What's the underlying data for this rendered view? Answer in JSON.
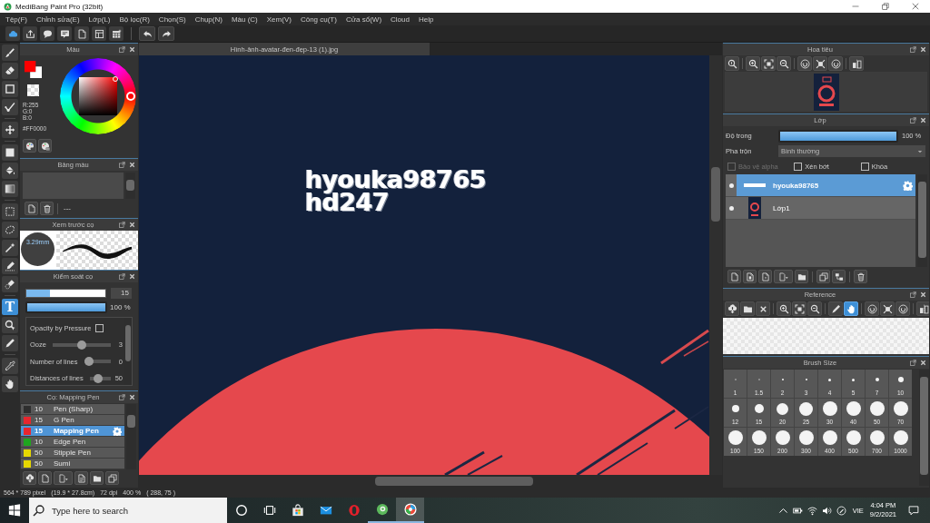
{
  "window": {
    "title": "MediBang Paint Pro (32bit)"
  },
  "menu": [
    "Tệp(F)",
    "Chỉnh sửa(E)",
    "Lớp(L)",
    "Bộ lọc(R)",
    "Chọn(S)",
    "Chụp(N)",
    "Màu (C)",
    "Xem(V)",
    "Công cụ(T)",
    "Cửa sổ(W)",
    "Cloud",
    "Help"
  ],
  "tools": [
    {
      "selected": false
    },
    {
      "selected": false
    },
    {
      "selected": false
    },
    {
      "selected": false
    },
    {
      "selected": false
    },
    {
      "selected": false
    },
    {
      "selected": false
    },
    {
      "selected": false
    },
    {
      "selected": false
    },
    {
      "selected": false
    },
    {
      "selected": false
    },
    {
      "selected": false
    },
    {
      "selected": false
    },
    {
      "label": "T",
      "selected": true
    },
    {
      "selected": false
    },
    {
      "selected": false
    },
    {
      "selected": false
    },
    {
      "selected": false
    }
  ],
  "color_panel": {
    "title": "Màu",
    "swatches": [
      {
        "color": "#ff0000"
      },
      {
        "color": "#ffffff"
      }
    ],
    "channels": [
      "R:255",
      "G:0",
      "B:0"
    ],
    "hex": "#FF0000"
  },
  "palette_panel": {
    "title": "Bảng màu",
    "palette_name": "---"
  },
  "brush_preview": {
    "title": "Xem trước cọ",
    "size": "3.29mm"
  },
  "brush_control": {
    "title": "Kiểm soát cọ",
    "size": {
      "level": 0.3,
      "value": "15"
    },
    "opacity": {
      "level": 1,
      "value": "100 %"
    },
    "options": [
      {
        "kind": "checkbox",
        "label": "Opacity by Pressure",
        "checked": false
      },
      {
        "kind": "slider",
        "label": "Ooze",
        "level": 0.5,
        "value": "3"
      },
      {
        "kind": "slider",
        "label": "Number of lines",
        "level": 0,
        "value": "0"
      },
      {
        "kind": "slider",
        "label": "Distances of lines",
        "level": 0.3,
        "value": "50"
      }
    ]
  },
  "brush_list": {
    "title": "Cọ: Mapping Pen",
    "items": [
      {
        "size": "10",
        "name": "Pen (Sharp)",
        "color": "#2e2e2e",
        "selected": false
      },
      {
        "size": "15",
        "name": "G Pen",
        "color": "#e8262e",
        "selected": false
      },
      {
        "size": "15",
        "name": "Mapping Pen",
        "color": "#e8262e",
        "selected": true
      },
      {
        "size": "10",
        "name": "Edge Pen",
        "color": "#1fa61f",
        "selected": false
      },
      {
        "size": "50",
        "name": "Stipple Pen",
        "color": "#e6d800",
        "selected": false
      },
      {
        "size": "50",
        "name": "Sumi",
        "color": "#e6d800",
        "selected": false
      }
    ]
  },
  "document": {
    "tab": "Hình-ảnh-avatar-đen-đẹp-13 (1).jpg",
    "text_lines": [
      "hyouka98765",
      "hd247"
    ]
  },
  "navigator": {
    "title": "Hoa tiêu"
  },
  "layers": {
    "title": "Lớp",
    "opacity": {
      "label": "Độ trong",
      "level": 1,
      "value": "100 %"
    },
    "blend": {
      "label": "Pha trộn",
      "value": "Bình thường"
    },
    "options": [
      {
        "label": "Bảo vệ alpha",
        "checked": false,
        "disabled": true
      },
      {
        "label": "Xén bớt",
        "checked": false,
        "disabled": false
      },
      {
        "label": "Khóa",
        "checked": false,
        "disabled": false
      }
    ],
    "items": [
      {
        "kind": "text",
        "name": "hyouka98765",
        "selected": true,
        "visible": true
      },
      {
        "kind": "image",
        "name": "Lớp1",
        "selected": false,
        "visible": true
      }
    ]
  },
  "reference": {
    "title": "Reference",
    "tools": [
      {
        "selected": false
      },
      {
        "selected": false
      },
      {
        "selected": false
      },
      {
        "selected": false
      },
      {
        "selected": false
      },
      {
        "selected": false
      },
      {
        "selected": false
      },
      {
        "selected": true
      },
      {
        "selected": false
      },
      {
        "selected": false
      },
      {
        "selected": false
      },
      {
        "selected": false
      }
    ]
  },
  "brush_size": {
    "title": "Brush Size",
    "sizes": [
      "1",
      "1.5",
      "2",
      "3",
      "4",
      "5",
      "7",
      "10",
      "12",
      "15",
      "20",
      "25",
      "30",
      "40",
      "50",
      "70",
      "100",
      "150",
      "200",
      "300",
      "400",
      "500",
      "700",
      "1000"
    ]
  },
  "status_bar": [
    "564 * 789 pixel",
    "(19.9 * 27.8cm)",
    "72 dpi",
    "400 %",
    "( 288, 75 )"
  ],
  "taskbar": {
    "search": {
      "placeholder": "Type here to search"
    },
    "apps": [
      {
        "running": false,
        "selected": false
      },
      {
        "running": false,
        "selected": false
      },
      {
        "running": false,
        "selected": false
      },
      {
        "running": true,
        "selected": false
      },
      {
        "running": true,
        "selected": true
      }
    ],
    "language": "VIE",
    "time": "4:04 PM",
    "date": "9/2/2021"
  }
}
